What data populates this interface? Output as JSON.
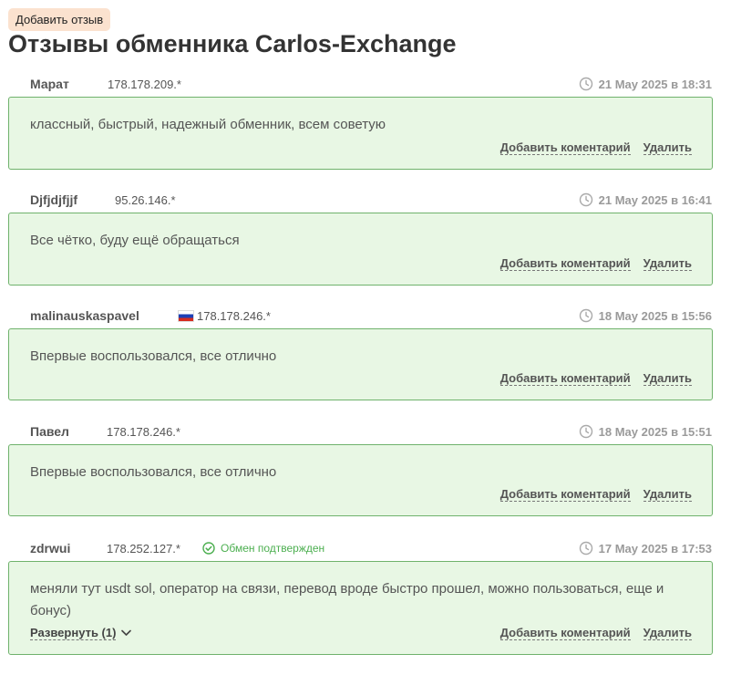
{
  "add_review_label": "Добавить отзыв",
  "page_title": "Отзывы обменника Carlos-Exchange",
  "action_labels": {
    "add_comment": "Добавить коментарий",
    "delete": "Удалить"
  },
  "reviews": [
    {
      "author": "Марат",
      "ip": "178.178.209.*",
      "date": "21 May 2025 в 18:31",
      "text": "классный, быстрый, надежный обменник, всем советую"
    },
    {
      "author": "Djfjdjfjjf",
      "ip": "95.26.146.*",
      "date": "21 May 2025 в 16:41",
      "text": "Все чётко, буду ещё обращаться"
    },
    {
      "author": "malinauskaspavel",
      "ip": "178.178.246.*",
      "date": "18 May 2025 в 15:56",
      "text": "Впервые воспользовался, все отлично",
      "flag": "ru-flag-icon"
    },
    {
      "author": "Павел",
      "ip": "178.178.246.*",
      "date": "18 May 2025 в 15:51",
      "text": "Впервые воспользовался, все отлично"
    },
    {
      "author": "zdrwui",
      "ip": "178.252.127.*",
      "date": "17 May 2025 в 17:53",
      "text": "меняли тут usdt sol, оператор на связи, перевод вроде быстро прошел, можно пользоваться, еще и бонус)",
      "confirmed": "Обмен подтвержден",
      "expand": "Развернуть (1)"
    }
  ],
  "colors": {
    "box_bg": "#e8f7e4",
    "box_border": "#6fb26c",
    "confirm": "#4caf50",
    "add_btn_bg": "#fbe2cf"
  }
}
